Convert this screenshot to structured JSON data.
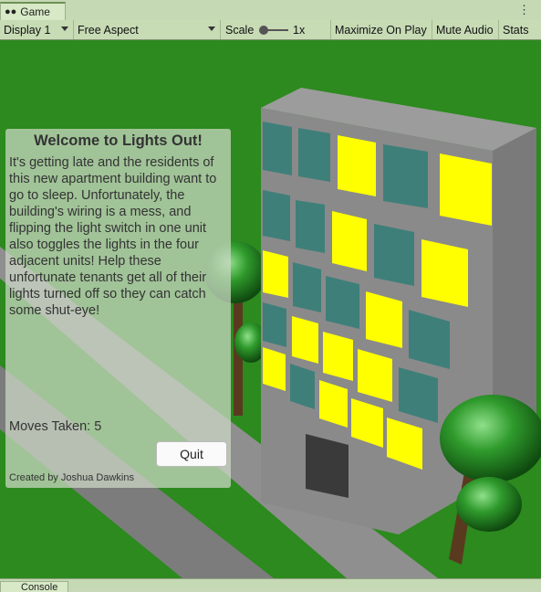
{
  "window": {
    "tab_label": "Game",
    "tab_icon": "gamepad-icon",
    "menu_icon": "kebab-menu-icon"
  },
  "toolbar": {
    "display": "Display 1",
    "aspect": "Free Aspect",
    "scale_label": "Scale",
    "scale_value": "1x",
    "maximize": "Maximize On Play",
    "mute": "Mute Audio",
    "stats": "Stats"
  },
  "panel": {
    "title": "Welcome to Lights Out!",
    "body": "It's getting late and the residents of this new apartment building want to go to sleep. Unfortunately, the building's wiring is a mess, and flipping the light switch in one unit also toggles the lights in the four adjacent units! Help these unfortunate tenants get all of their lights turned off so they can catch some shut-eye!",
    "moves": "Moves Taken: 5",
    "quit": "Quit",
    "credit": "Created by Joshua Dawkins"
  },
  "bottom": {
    "console_tab": "Console"
  },
  "colors": {
    "grass": "#2c8a1e",
    "light_on": "#ffff00",
    "light_off": "#3f7f7a",
    "building": "#8a8a8a"
  }
}
